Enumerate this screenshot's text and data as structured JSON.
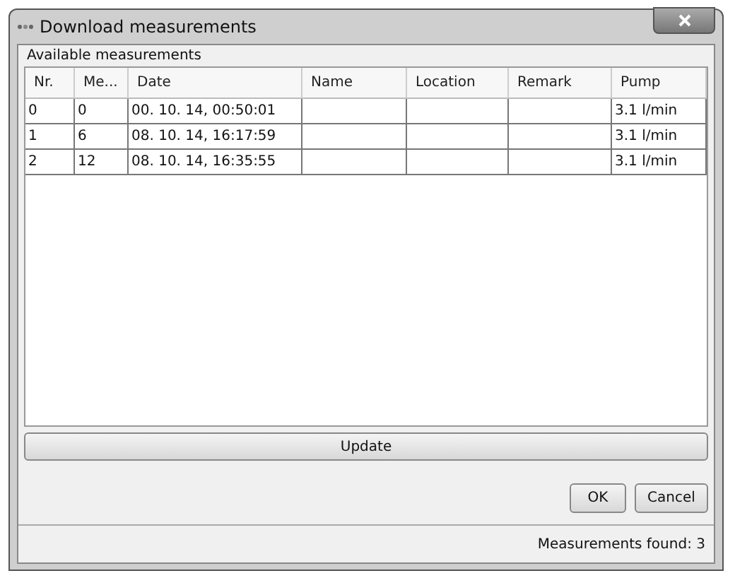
{
  "window": {
    "title": "Download measurements"
  },
  "group": {
    "label": "Available measurements"
  },
  "table": {
    "columns": [
      "Nr.",
      "Me...",
      "Date",
      "Name",
      "Location",
      "Remark",
      "Pump"
    ],
    "rows": [
      [
        "0",
        "0",
        "00. 10. 14, 00:50:01",
        "",
        "",
        "",
        "3.1 l/min"
      ],
      [
        "1",
        "6",
        "08. 10. 14, 16:17:59",
        "",
        "",
        "",
        "3.1 l/min"
      ],
      [
        "2",
        "12",
        "08. 10. 14, 16:35:55",
        "",
        "",
        "",
        "3.1 l/min"
      ]
    ]
  },
  "update_button": "Update",
  "buttons": [
    "OK",
    "Cancel"
  ],
  "status_bar": "Measurements found: 3"
}
